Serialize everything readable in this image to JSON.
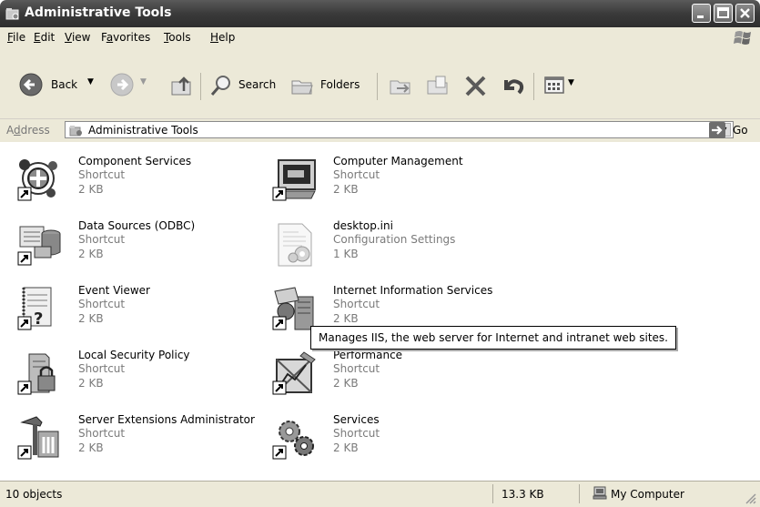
{
  "window": {
    "title": "Administrative Tools"
  },
  "menu": [
    {
      "pre": "",
      "u": "F",
      "post": "ile"
    },
    {
      "pre": "",
      "u": "E",
      "post": "dit"
    },
    {
      "pre": "",
      "u": "V",
      "post": "iew"
    },
    {
      "pre": "F",
      "u": "a",
      "post": "vorites"
    },
    {
      "pre": "",
      "u": "T",
      "post": "ools"
    },
    {
      "pre": "",
      "u": "H",
      "post": "elp"
    }
  ],
  "toolbar": {
    "back_label": "Back",
    "search_label": "Search",
    "folders_label": "Folders"
  },
  "address": {
    "label_pre": "A",
    "label_u": "d",
    "label_post": "dress",
    "value": "Administrative Tools",
    "go_label": "Go"
  },
  "items": [
    {
      "name": "Component Services",
      "type": "Shortcut",
      "size": "2 KB",
      "icon": "component-services-icon"
    },
    {
      "name": "Computer Management",
      "type": "Shortcut",
      "size": "2 KB",
      "icon": "computer-management-icon"
    },
    {
      "name": "Data Sources (ODBC)",
      "type": "Shortcut",
      "size": "2 KB",
      "icon": "data-sources-icon"
    },
    {
      "name": "desktop.ini",
      "type": "Configuration Settings",
      "size": "1 KB",
      "icon": "config-file-icon"
    },
    {
      "name": "Event Viewer",
      "type": "Shortcut",
      "size": "2 KB",
      "icon": "event-viewer-icon"
    },
    {
      "name": "Internet Information Services",
      "type": "Shortcut",
      "size": "2 KB",
      "icon": "iis-icon"
    },
    {
      "name": "Local Security Policy",
      "type": "Shortcut",
      "size": "2 KB",
      "icon": "security-policy-icon"
    },
    {
      "name": "Performance",
      "type": "Shortcut",
      "size": "2 KB",
      "icon": "performance-icon"
    },
    {
      "name": "Server Extensions Administrator",
      "type": "Shortcut",
      "size": "2 KB",
      "icon": "server-extensions-icon"
    },
    {
      "name": "Services",
      "type": "Shortcut",
      "size": "2 KB",
      "icon": "services-icon"
    }
  ],
  "tooltip": "Manages IIS, the web server for Internet and intranet web sites.",
  "status": {
    "objects": "10 objects",
    "size": "13.3 KB",
    "zone": "My Computer"
  }
}
